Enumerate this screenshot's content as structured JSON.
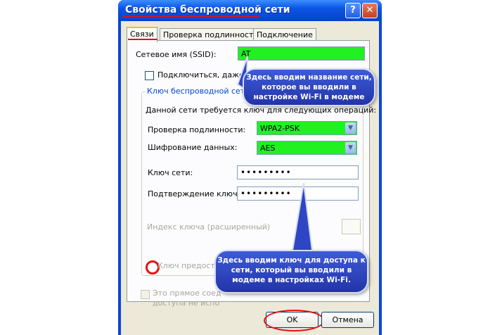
{
  "window": {
    "title": "Свойства беспроводной сети",
    "help_glyph": "?",
    "close_glyph": "✕"
  },
  "tabs": [
    {
      "label": "Связи",
      "active": true
    },
    {
      "label": "Проверка подлинности",
      "active": false
    },
    {
      "label": "Подключение",
      "active": false
    }
  ],
  "form": {
    "ssid_label": "Сетевое имя (SSID):",
    "ssid_value": "AT",
    "connect_checkbox_label": "Подключиться, даже ес",
    "group_label": "Ключ беспроводной сети",
    "requires_key_text": "Данной сети требуется ключ для следующих операций:",
    "auth_label": "Проверка подлинности:",
    "auth_value": "WPA2-PSK",
    "encryption_label": "Шифрование данных:",
    "encryption_value": "AES",
    "network_key_label": "Ключ сети:",
    "network_key_value": "•••••••••",
    "confirm_key_label": "Подтверждение ключа:",
    "confirm_key_value": "•••••••••",
    "key_index_label": "Индекс ключа (расширенный)",
    "auto_key_label": "Ключ предоставлен автоматически",
    "adhoc_label_line1": "Это прямое соед",
    "adhoc_label_line2": "доступа не испо"
  },
  "buttons": {
    "ok": "OK",
    "cancel": "Отмена"
  },
  "callouts": {
    "ssid_note": "Здесь вводим название сети, которое вы вводили в настройке Wi-Fi в модеме",
    "key_note": "Здесь вводим ключ для доступа к сети, который вы вводили в модеме в настройках Wi-Fi."
  },
  "colors": {
    "highlight_green": "#21f021",
    "annotation_red": "#e81010",
    "callout_blue": "#2f46c4"
  }
}
